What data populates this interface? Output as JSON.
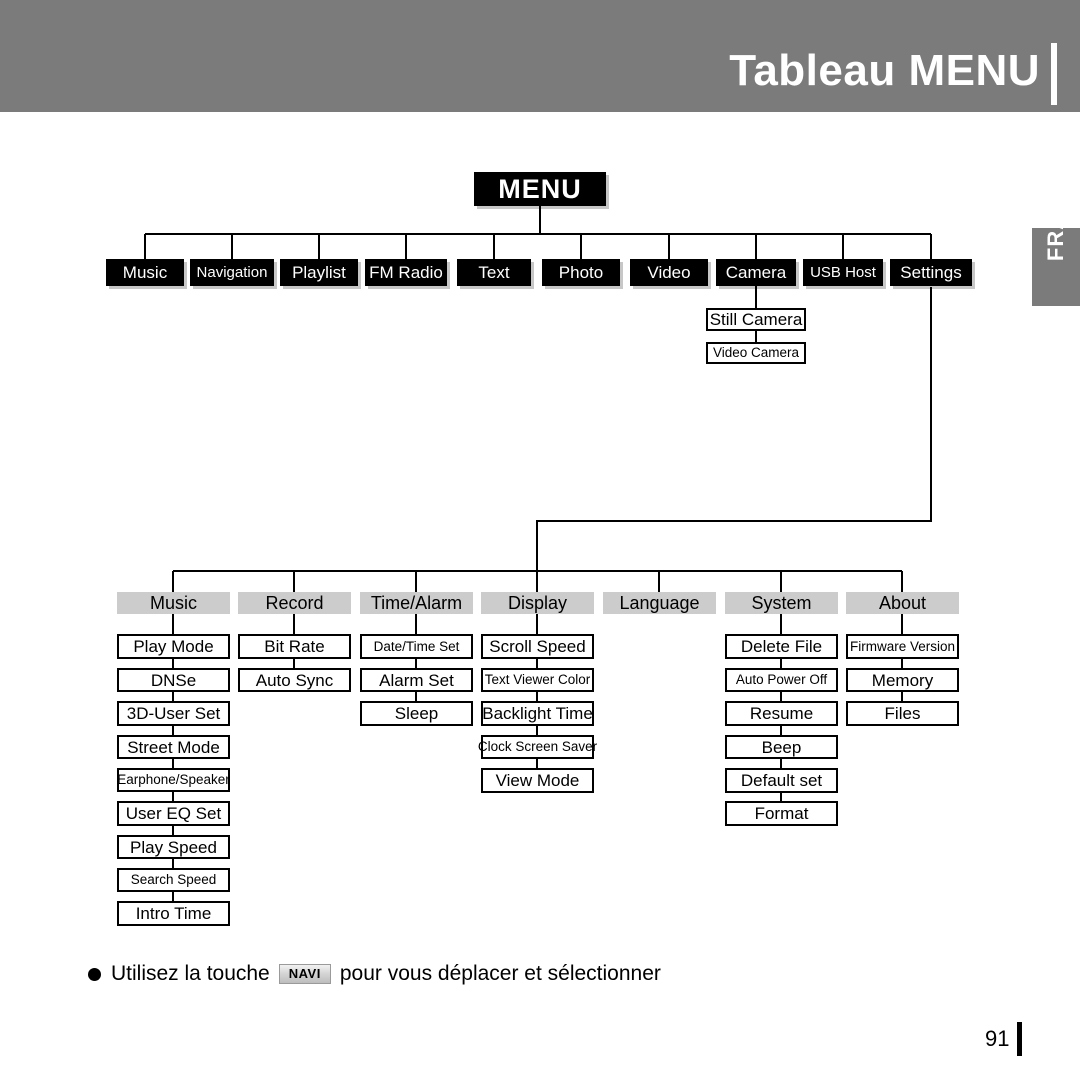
{
  "header": {
    "title": "Tableau MENU"
  },
  "side_tab": {
    "label": "FRA"
  },
  "page": {
    "number": "91"
  },
  "footnote": {
    "bullet": "bullet-icon",
    "text_before": "Utilisez la touche",
    "key_label": "NAVI",
    "text_after": "pour vous déplacer et sélectionner"
  },
  "colors": {
    "header_band": "#7b7b7b",
    "node_dark": "#000000",
    "group_gray": "#cccccc",
    "page_background": "#ffffff"
  },
  "diagram": {
    "type": "menu-tree",
    "root": {
      "label": "MENU"
    },
    "level1": [
      {
        "label": "Music"
      },
      {
        "label": "Navigation"
      },
      {
        "label": "Playlist"
      },
      {
        "label": "FM Radio"
      },
      {
        "label": "Text"
      },
      {
        "label": "Photo"
      },
      {
        "label": "Video"
      },
      {
        "label": "Camera"
      },
      {
        "label": "USB Host"
      },
      {
        "label": "Settings"
      }
    ],
    "camera_children": [
      {
        "label": "Still Camera"
      },
      {
        "label": "Video Camera"
      }
    ],
    "settings_groups": [
      {
        "label": "Music",
        "items": [
          {
            "label": "Play Mode"
          },
          {
            "label": "DNSe"
          },
          {
            "label": "3D-User Set"
          },
          {
            "label": "Street Mode"
          },
          {
            "label": "Earphone/Speaker"
          },
          {
            "label": "User EQ Set"
          },
          {
            "label": "Play Speed"
          },
          {
            "label": "Search Speed"
          },
          {
            "label": "Intro Time"
          }
        ]
      },
      {
        "label": "Record",
        "items": [
          {
            "label": "Bit Rate"
          },
          {
            "label": "Auto Sync"
          }
        ]
      },
      {
        "label": "Time/Alarm",
        "items": [
          {
            "label": "Date/Time Set"
          },
          {
            "label": "Alarm Set"
          },
          {
            "label": "Sleep"
          }
        ]
      },
      {
        "label": "Display",
        "items": [
          {
            "label": "Scroll Speed"
          },
          {
            "label": "Text Viewer Color"
          },
          {
            "label": "Backlight Time"
          },
          {
            "label": "Clock Screen Saver"
          },
          {
            "label": "View Mode"
          }
        ]
      },
      {
        "label": "Language",
        "items": []
      },
      {
        "label": "System",
        "items": [
          {
            "label": "Delete File"
          },
          {
            "label": "Auto Power Off"
          },
          {
            "label": "Resume"
          },
          {
            "label": "Beep"
          },
          {
            "label": "Default set"
          },
          {
            "label": "Format"
          }
        ]
      },
      {
        "label": "About",
        "items": [
          {
            "label": "Firmware Version"
          },
          {
            "label": "Memory"
          },
          {
            "label": "Files"
          }
        ]
      }
    ]
  }
}
